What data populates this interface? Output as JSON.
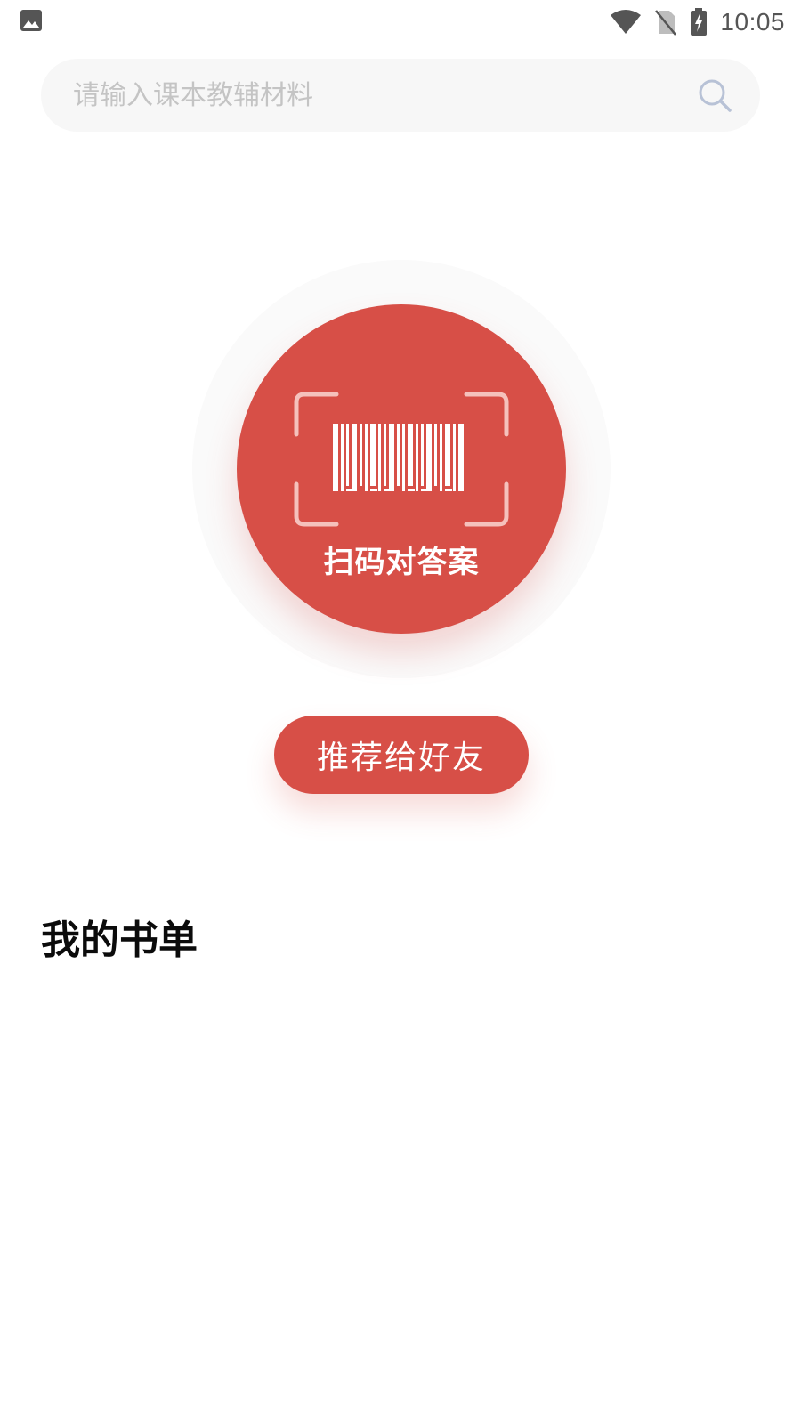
{
  "status_bar": {
    "time": "10:05",
    "icons": [
      "gallery-icon",
      "wifi-icon",
      "no-sim-icon",
      "battery-charging-icon"
    ]
  },
  "search": {
    "placeholder": "请输入课本教辅材料",
    "value": "",
    "icon": "search-icon"
  },
  "scan": {
    "label": "扫码对答案",
    "icon": "barcode-scan-icon"
  },
  "recommend": {
    "label": "推荐给好友"
  },
  "book_list": {
    "title": "我的书单",
    "items": []
  },
  "colors": {
    "accent": "#d74f47",
    "search_bg": "#f7f7f7",
    "placeholder": "#c4c4c4",
    "search_icon": "#b8c2d6"
  }
}
